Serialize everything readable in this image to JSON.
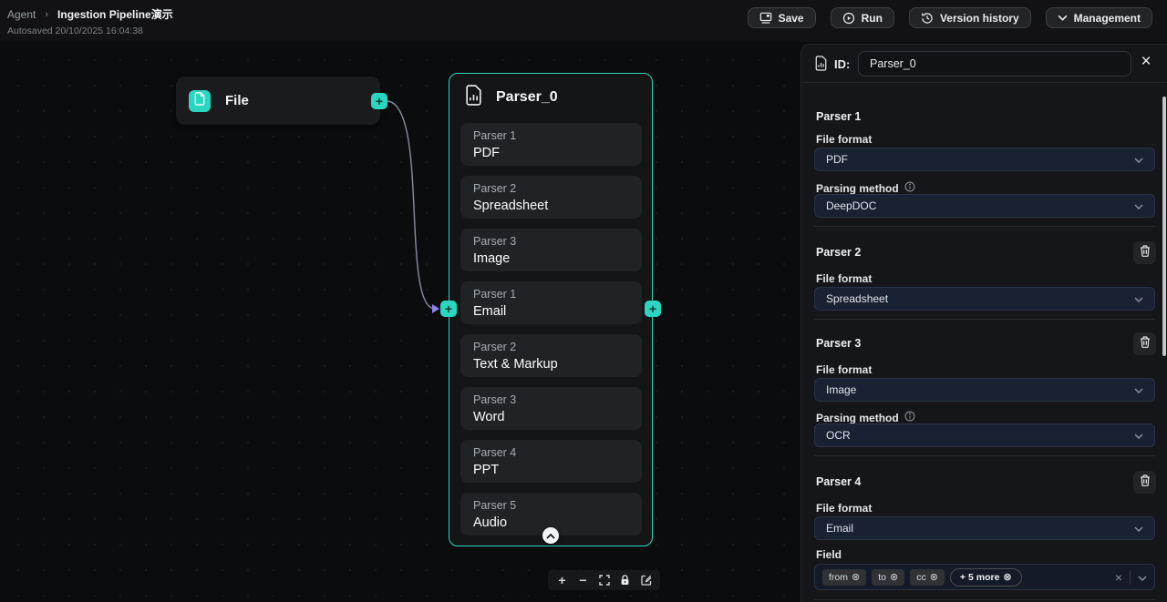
{
  "header": {
    "breadcrumb": {
      "root": "Agent",
      "separator": "›",
      "current": "Ingestion Pipeline演示"
    },
    "autosaved": "Autosaved 20/10/2025 16:04:38",
    "buttons": {
      "save": "Save",
      "run": "Run",
      "version_history": "Version history",
      "management": "Management"
    }
  },
  "canvas": {
    "file_node": {
      "title": "File"
    },
    "parser_node": {
      "title": "Parser_0",
      "items": [
        {
          "label": "Parser 1",
          "value": "PDF"
        },
        {
          "label": "Parser 2",
          "value": "Spreadsheet"
        },
        {
          "label": "Parser 3",
          "value": "Image"
        },
        {
          "label": "Parser 1",
          "value": "Email"
        },
        {
          "label": "Parser 2",
          "value": "Text & Markup"
        },
        {
          "label": "Parser 3",
          "value": "Word"
        },
        {
          "label": "Parser 4",
          "value": "PPT"
        },
        {
          "label": "Parser 5",
          "value": "Audio"
        }
      ]
    }
  },
  "panel": {
    "id_label": "ID:",
    "id_value": "Parser_0",
    "sections": [
      {
        "title": "Parser 1",
        "fields": [
          {
            "label": "File format",
            "value": "PDF"
          },
          {
            "label": "Parsing method",
            "value": "DeepDOC"
          }
        ]
      },
      {
        "title": "Parser 2",
        "fields": [
          {
            "label": "File format",
            "value": "Spreadsheet"
          }
        ]
      },
      {
        "title": "Parser 3",
        "fields": [
          {
            "label": "File format",
            "value": "Image"
          },
          {
            "label": "Parsing method",
            "value": "OCR"
          }
        ]
      },
      {
        "title": "Parser 4",
        "fields": [
          {
            "label": "File format",
            "value": "Email"
          },
          {
            "label": "Field"
          }
        ],
        "tags": [
          "from",
          "to",
          "cc"
        ],
        "more_label": "+ 5 more"
      }
    ]
  },
  "icons": {
    "plus": "+",
    "minus": "−",
    "close": "×",
    "tag_remove": "⊗",
    "handle_plus": "+"
  },
  "colors": {
    "accent": "#2BD6C0",
    "node_border": "#2FD5BF",
    "canvas_bg": "#0B0C0E",
    "panel_bg": "#151619",
    "select_bg": "#1A2133",
    "edge": "#8B8B9E",
    "arrow": "#8F83F3"
  }
}
